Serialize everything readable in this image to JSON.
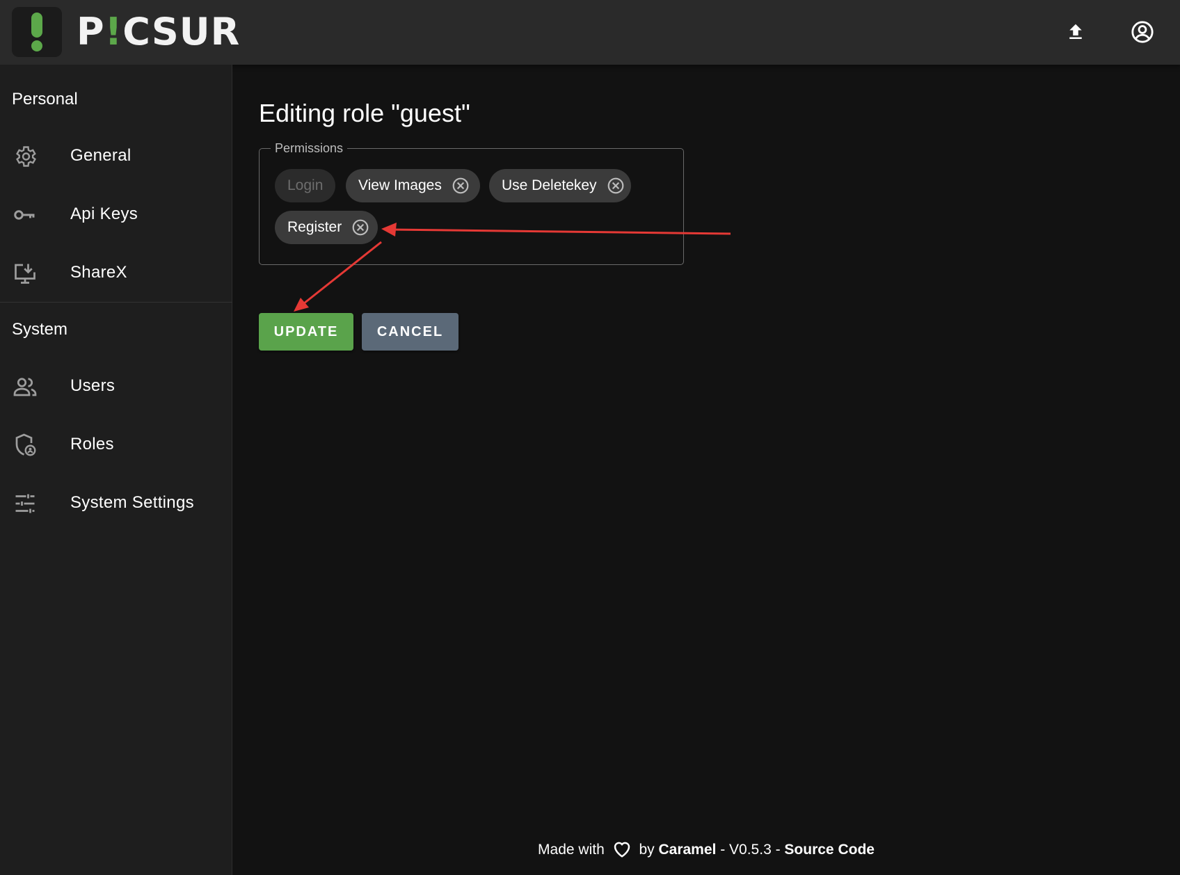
{
  "header": {
    "logo_text_p": "P",
    "logo_text_rest": "CSUR",
    "upload_icon": "upload-icon",
    "account_icon": "account-circle-icon"
  },
  "sidebar": {
    "personal_title": "Personal",
    "personal_items": [
      {
        "label": "General",
        "icon": "gear-icon"
      },
      {
        "label": "Api Keys",
        "icon": "key-icon"
      },
      {
        "label": "ShareX",
        "icon": "download-monitor-icon"
      }
    ],
    "system_title": "System",
    "system_items": [
      {
        "label": "Users",
        "icon": "users-icon"
      },
      {
        "label": "Roles",
        "icon": "shield-user-icon"
      },
      {
        "label": "System Settings",
        "icon": "sliders-icon"
      }
    ]
  },
  "main": {
    "title": "Editing role \"guest\"",
    "permissions_legend": "Permissions",
    "chips": [
      {
        "label": "Login",
        "disabled": true
      },
      {
        "label": "View Images",
        "disabled": false
      },
      {
        "label": "Use Deletekey",
        "disabled": false
      },
      {
        "label": "Register",
        "disabled": false
      }
    ],
    "update_label": "UPDATE",
    "cancel_label": "CANCEL"
  },
  "footer": {
    "made_with": "Made with",
    "by": "by",
    "author": "Caramel",
    "version": " - V0.5.3 - ",
    "source": "Source Code"
  },
  "colors": {
    "accent_green": "#5aa34b",
    "cancel_gray": "#5b6978",
    "annotation_red": "#e53935"
  }
}
